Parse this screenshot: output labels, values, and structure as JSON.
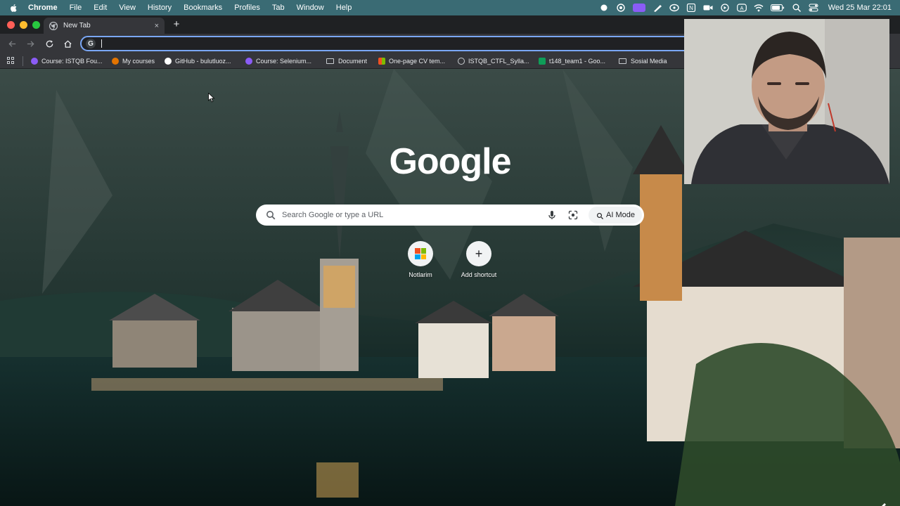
{
  "menubar": {
    "app_name": "Chrome",
    "items": [
      "File",
      "Edit",
      "View",
      "History",
      "Bookmarks",
      "Profiles",
      "Tab",
      "Window",
      "Help"
    ],
    "datetime": "Wed 25 Mar  22:01",
    "status_icons": [
      "record-icon",
      "cloud-icon",
      "screen-share-icon",
      "pen-icon",
      "vpn-icon",
      "notion-icon",
      "camera-icon",
      "play-icon",
      "keyboard-icon",
      "wifi-icon",
      "battery-icon",
      "search-icon",
      "control-center-icon"
    ]
  },
  "tab": {
    "title": "New Tab",
    "close_glyph": "×",
    "new_tab_glyph": "+"
  },
  "omnibox": {
    "value": "",
    "badge": "G"
  },
  "bookmarks": [
    {
      "label": "Course: ISTQB Fou...",
      "icon": "course-icon",
      "color": "#8b5cf6"
    },
    {
      "label": "My courses",
      "icon": "courses-icon",
      "color": "#e37400"
    },
    {
      "label": "GitHub - bulutluoz...",
      "icon": "github-icon",
      "color": "#ffffff"
    },
    {
      "label": "Course: Selenium...",
      "icon": "course-icon",
      "color": "#8b5cf6"
    },
    {
      "label": "Document",
      "icon": "folder-icon",
      "color": "#c8ccd0"
    },
    {
      "label": "One-page CV tem...",
      "icon": "microsoft-icon",
      "color": "#f25022"
    },
    {
      "label": "ISTQB_CTFL_Sylla...",
      "icon": "globe-icon",
      "color": "#c8ccd0"
    },
    {
      "label": "t148_team1 - Goo...",
      "icon": "sheets-icon",
      "color": "#0f9d58"
    },
    {
      "label": "Sosial Media",
      "icon": "folder-icon",
      "color": "#c8ccd0"
    }
  ],
  "ntp": {
    "logo": "Google",
    "search_placeholder": "Search Google or type a URL",
    "ai_mode_label": "AI Mode",
    "shortcuts": [
      {
        "label": "Notlarim",
        "icon": "microsoft-icon"
      },
      {
        "label": "Add shortcut",
        "icon": "plus-icon",
        "glyph": "+"
      }
    ]
  },
  "colors": {
    "menubar_bg": "#3a6b74",
    "tabstrip_bg": "#1f2123",
    "toolbar_bg": "#35363a",
    "omnibox_focus": "#7aa7f5",
    "ms_red": "#f25022",
    "ms_green": "#7fba00",
    "ms_blue": "#00a4ef",
    "ms_yellow": "#ffb900"
  }
}
